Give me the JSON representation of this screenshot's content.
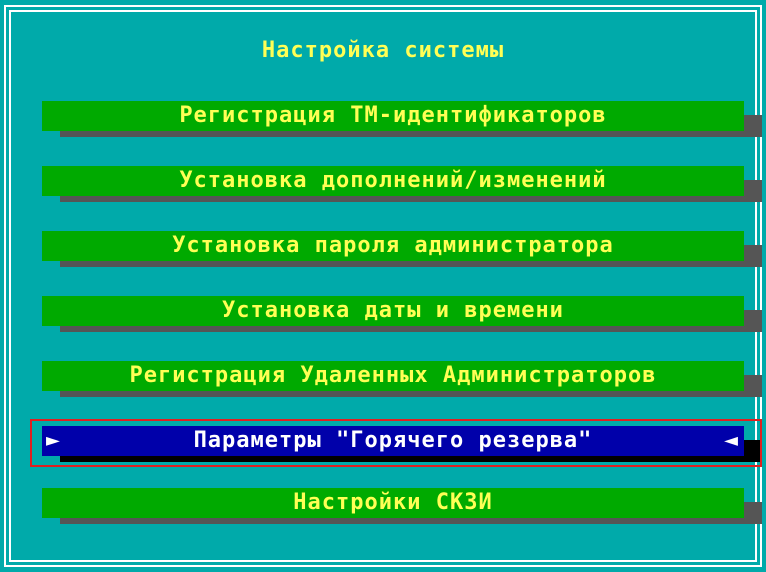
{
  "screen": {
    "title": "Настройка системы",
    "colors": {
      "background": "#00aaaa",
      "item_background": "#00aa00",
      "item_text": "#ffff55",
      "selected_background": "#0000aa",
      "selected_text": "#ffffff",
      "shadow": "#555555",
      "highlight_border": "#e02020"
    }
  },
  "menu": {
    "items": [
      {
        "label": "Регистрация ТМ-идентификаторов",
        "selected": false
      },
      {
        "label": "Установка дополнений/изменений",
        "selected": false
      },
      {
        "label": "Установка пароля администратора",
        "selected": false
      },
      {
        "label": "Установка даты и времени",
        "selected": false
      },
      {
        "label": "Регистрация Удаленных Администраторов",
        "selected": false
      },
      {
        "label": "Параметры \"Горячего резерва\"",
        "selected": true
      },
      {
        "label": "Настройки СКЗИ",
        "selected": false
      }
    ],
    "selection_arrows": {
      "left": "►",
      "right": "◄"
    }
  }
}
